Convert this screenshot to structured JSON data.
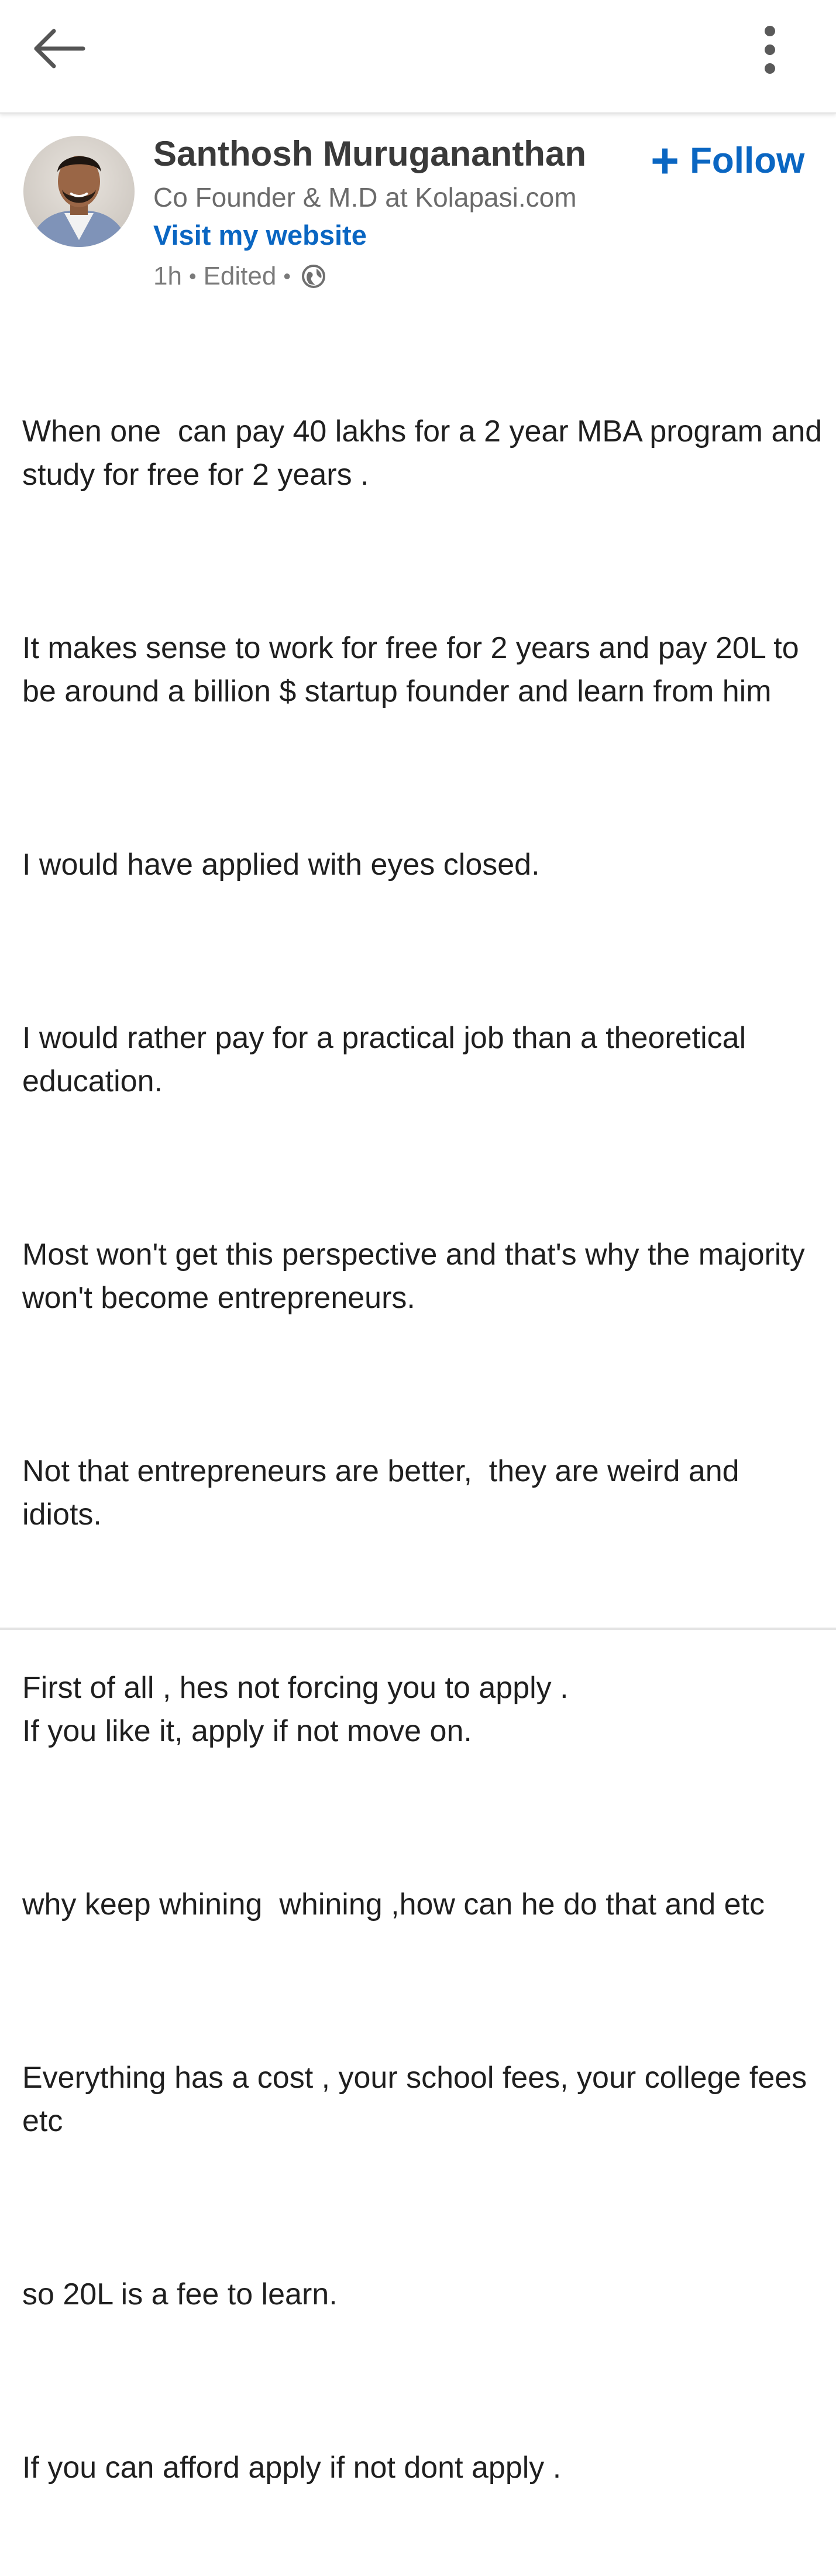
{
  "topbar": {
    "back_icon": "arrow-left-icon",
    "more_icon": "vertical-ellipsis-icon"
  },
  "author": {
    "name": "Santhosh Murugananthan",
    "headline": "Co Founder & M.D at Kolapasi.com",
    "website_label": "Visit my website",
    "time": "1h",
    "edited_label": "Edited",
    "visibility_icon": "globe-icon"
  },
  "follow": {
    "icon": "plus-icon",
    "label": "Follow"
  },
  "post": {
    "paragraphs": [
      "When one  can pay 40 lakhs for a 2 year MBA program and study for free for 2 years .",
      "It makes sense to work for free for 2 years and pay 20L to be around a billion $ startup founder and learn from him",
      "I would have applied with eyes closed.",
      "I would rather pay for a practical job than a theoretical education.",
      "Most won't get this perspective and that's why the majority won't become entrepreneurs.",
      "Not that entrepreneurs are better,  they are weird and idiots.",
      "First of all , hes not forcing you to apply .\nIf you like it, apply if not move on.",
      "why keep whining  whining ,how can he do that and etc",
      "Everything has a cost , your school fees, your college fees etc",
      "so 20L is a fee to learn.",
      "If you can afford apply if not dont apply ."
    ]
  },
  "colors": {
    "accent": "#0a66c2",
    "text": "#1f1f1f",
    "secondary_text": "#6b6b6b"
  }
}
